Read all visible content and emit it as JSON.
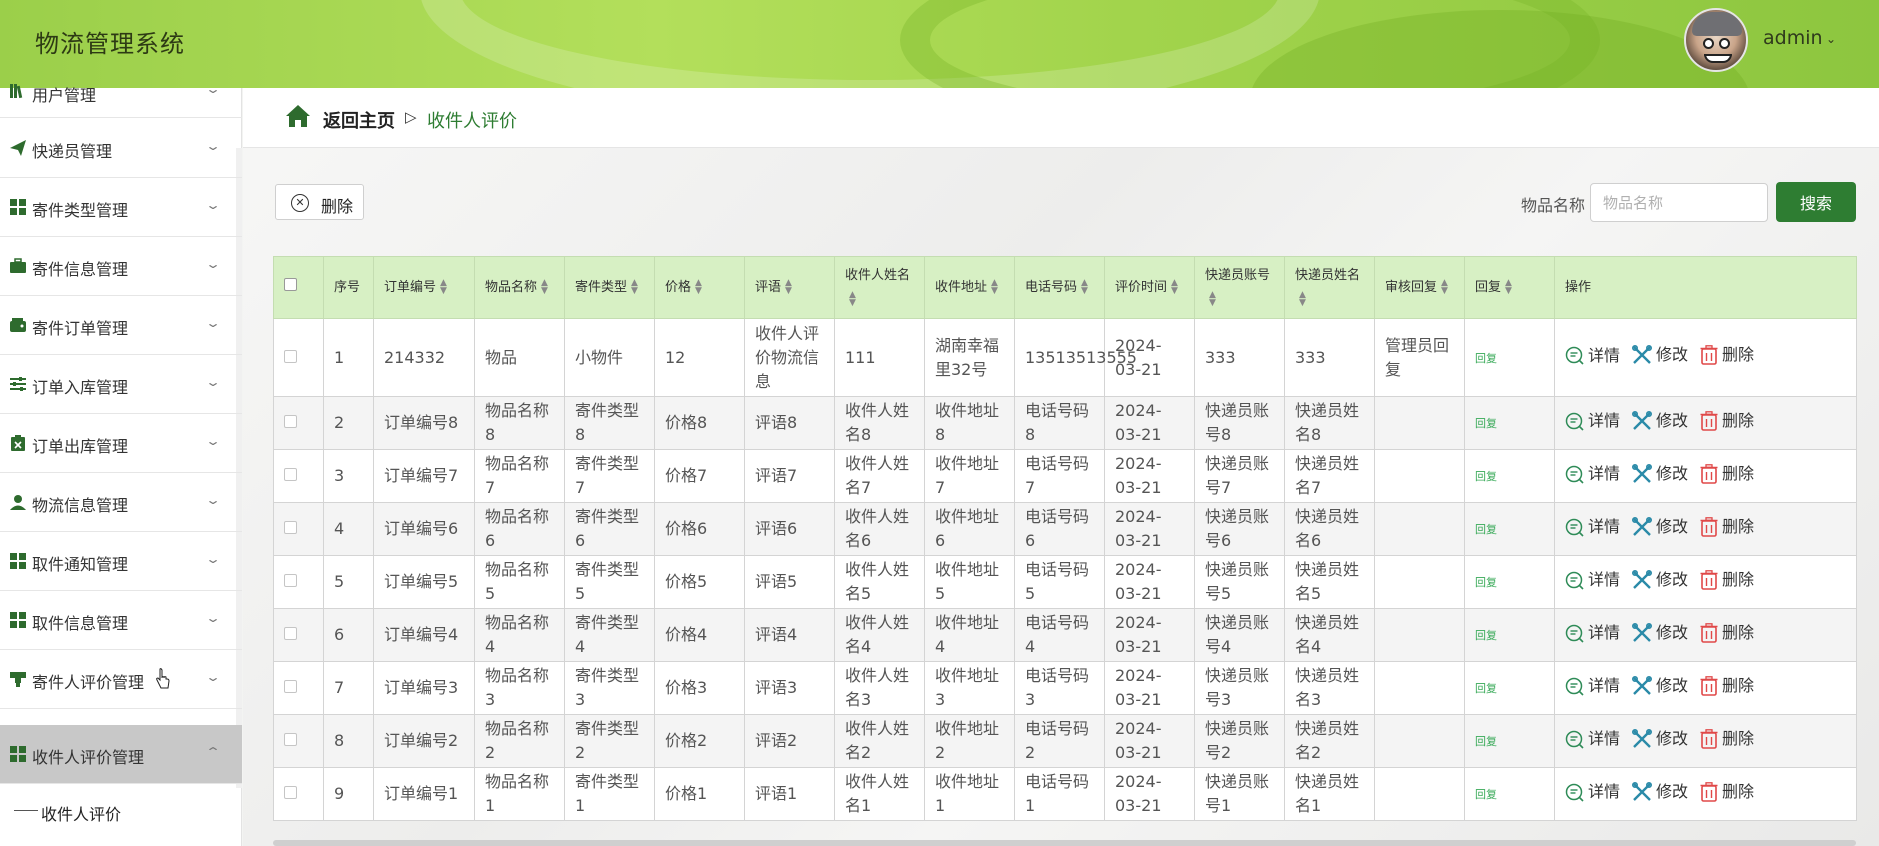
{
  "app": {
    "title": "物流管理系统"
  },
  "user": {
    "name": "admin"
  },
  "sidebar": {
    "items": [
      {
        "label": "用户管理",
        "icon": "book-icon"
      },
      {
        "label": "快递员管理",
        "icon": "paper-plane-icon"
      },
      {
        "label": "寄件类型管理",
        "icon": "grid-icon"
      },
      {
        "label": "寄件信息管理",
        "icon": "briefcase-icon"
      },
      {
        "label": "寄件订单管理",
        "icon": "wallet-icon"
      },
      {
        "label": "订单入库管理",
        "icon": "sliders-icon"
      },
      {
        "label": "订单出库管理",
        "icon": "clipboard-icon"
      },
      {
        "label": "物流信息管理",
        "icon": "user-icon"
      },
      {
        "label": "取件通知管理",
        "icon": "grid-icon"
      },
      {
        "label": "取件信息管理",
        "icon": "grid-icon"
      },
      {
        "label": "寄件人评价管理",
        "icon": "stamp-icon"
      },
      {
        "label": "收件人评价管理",
        "icon": "grid-icon",
        "active": true
      }
    ],
    "sub_item": "收件人评价"
  },
  "breadcrumb": {
    "home": "返回主页",
    "separator": "▷",
    "current": "收件人评价"
  },
  "toolbar": {
    "delete_label": "删除",
    "search_label": "物品名称",
    "search_placeholder": "物品名称",
    "search_button": "搜索"
  },
  "table": {
    "headers": [
      "序号",
      "订单编号",
      "物品名称",
      "寄件类型",
      "价格",
      "评语",
      "收件人姓名",
      "收件地址",
      "电话号码",
      "评价时间",
      "快递员账号",
      "快递员姓名",
      "审核回复",
      "回复",
      "操作"
    ],
    "actions": {
      "detail": "详情",
      "edit": "修改",
      "delete": "删除"
    },
    "rows": [
      [
        "1",
        "214332",
        "物品",
        "小物件",
        "12",
        "收件人评价物流信息",
        "111",
        "湖南幸福里32号",
        "13513513555",
        "2024-03-21",
        "333",
        "333",
        "管理员回复",
        "回复"
      ],
      [
        "2",
        "订单编号8",
        "物品名称8",
        "寄件类型8",
        "价格8",
        "评语8",
        "收件人姓名8",
        "收件地址8",
        "电话号码8",
        "2024-03-21",
        "快递员账号8",
        "快递员姓名8",
        "",
        "回复"
      ],
      [
        "3",
        "订单编号7",
        "物品名称7",
        "寄件类型7",
        "价格7",
        "评语7",
        "收件人姓名7",
        "收件地址7",
        "电话号码7",
        "2024-03-21",
        "快递员账号7",
        "快递员姓名7",
        "",
        "回复"
      ],
      [
        "4",
        "订单编号6",
        "物品名称6",
        "寄件类型6",
        "价格6",
        "评语6",
        "收件人姓名6",
        "收件地址6",
        "电话号码6",
        "2024-03-21",
        "快递员账号6",
        "快递员姓名6",
        "",
        "回复"
      ],
      [
        "5",
        "订单编号5",
        "物品名称5",
        "寄件类型5",
        "价格5",
        "评语5",
        "收件人姓名5",
        "收件地址5",
        "电话号码5",
        "2024-03-21",
        "快递员账号5",
        "快递员姓名5",
        "",
        "回复"
      ],
      [
        "6",
        "订单编号4",
        "物品名称4",
        "寄件类型4",
        "价格4",
        "评语4",
        "收件人姓名4",
        "收件地址4",
        "电话号码4",
        "2024-03-21",
        "快递员账号4",
        "快递员姓名4",
        "",
        "回复"
      ],
      [
        "7",
        "订单编号3",
        "物品名称3",
        "寄件类型3",
        "价格3",
        "评语3",
        "收件人姓名3",
        "收件地址3",
        "电话号码3",
        "2024-03-21",
        "快递员账号3",
        "快递员姓名3",
        "",
        "回复"
      ],
      [
        "8",
        "订单编号2",
        "物品名称2",
        "寄件类型2",
        "价格2",
        "评语2",
        "收件人姓名2",
        "收件地址2",
        "电话号码2",
        "2024-03-21",
        "快递员账号2",
        "快递员姓名2",
        "",
        "回复"
      ],
      [
        "9",
        "订单编号1",
        "物品名称1",
        "寄件类型1",
        "价格1",
        "评语1",
        "收件人姓名1",
        "收件地址1",
        "电话号码1",
        "2024-03-21",
        "快递员账号1",
        "快递员姓名1",
        "",
        "回复"
      ]
    ]
  },
  "colors": {
    "accent": "#2e7d32",
    "header_green": "#a2d44c",
    "table_header": "#d7f0c4",
    "reply_link": "#37a957",
    "delete_red": "#e04848",
    "edit_teal": "#2a8aa8"
  }
}
